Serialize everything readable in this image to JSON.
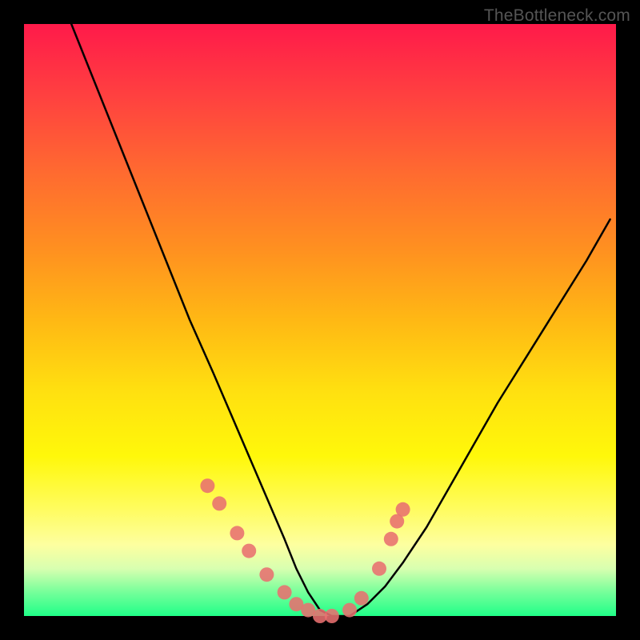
{
  "watermark": "TheBottleneck.com",
  "chart_data": {
    "type": "line",
    "title": "",
    "xlabel": "",
    "ylabel": "",
    "xlim": [
      0,
      100
    ],
    "ylim": [
      0,
      100
    ],
    "series": [
      {
        "name": "bottleneck-curve",
        "x": [
          8,
          12,
          16,
          20,
          24,
          28,
          32,
          35,
          38,
          41,
          44,
          46,
          48,
          50,
          52,
          55,
          58,
          61,
          64,
          68,
          72,
          76,
          80,
          85,
          90,
          95,
          99
        ],
        "values": [
          100,
          90,
          80,
          70,
          60,
          50,
          41,
          34,
          27,
          20,
          13,
          8,
          4,
          1,
          0,
          0,
          2,
          5,
          9,
          15,
          22,
          29,
          36,
          44,
          52,
          60,
          67
        ]
      }
    ],
    "markers": {
      "name": "data-points",
      "color": "#e87070",
      "x": [
        31,
        33,
        36,
        38,
        41,
        44,
        46,
        48,
        50,
        52,
        55,
        57,
        60,
        62,
        63,
        64
      ],
      "values": [
        22,
        19,
        14,
        11,
        7,
        4,
        2,
        1,
        0,
        0,
        1,
        3,
        8,
        13,
        16,
        18
      ]
    }
  }
}
